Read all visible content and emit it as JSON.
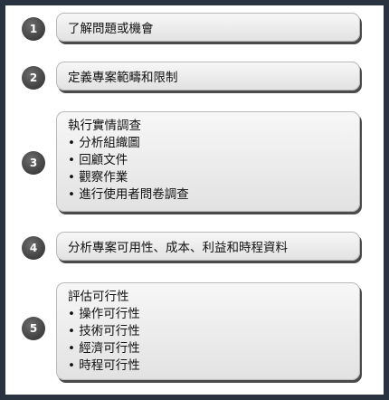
{
  "steps": [
    {
      "number": "1",
      "title": "了解問題或機會",
      "bullets": []
    },
    {
      "number": "2",
      "title": "定義專案範疇和限制",
      "bullets": []
    },
    {
      "number": "3",
      "title": "執行實情調查",
      "bullets": [
        "• 分析組織圖",
        "• 回顧文件",
        "• 觀察作業",
        "• 進行使用者問卷調查"
      ]
    },
    {
      "number": "4",
      "title": "分析專案可用性、成本、利益和時程資料",
      "bullets": []
    },
    {
      "number": "5",
      "title": "評估可行性",
      "bullets": [
        "• 操作可行性",
        "• 技術可行性",
        "• 經濟可行性",
        "• 時程可行性"
      ]
    }
  ]
}
